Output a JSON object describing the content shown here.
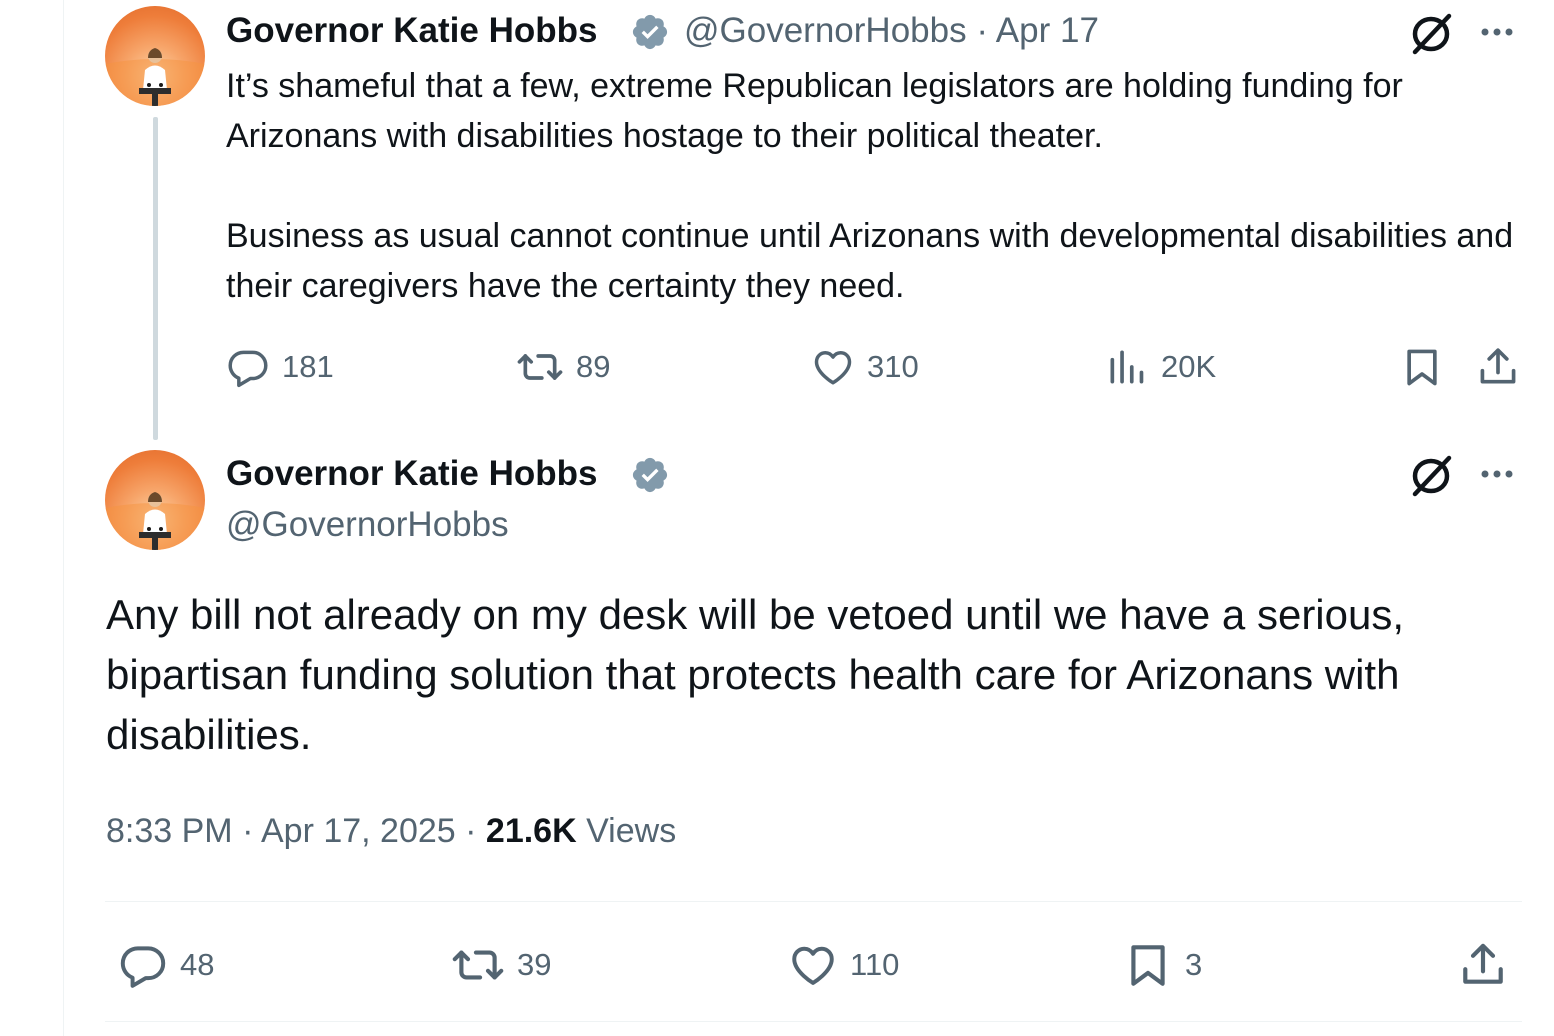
{
  "first_tweet": {
    "author_name": "Governor Katie Hobbs",
    "handle": "@GovernorHobbs",
    "separator": "·",
    "date": "Apr 17",
    "paragraph1": "It’s shameful that a few, extreme Republican legislators are holding funding for Arizonans with disabilities hostage to their political theater.",
    "paragraph2": "Business as usual cannot continue until Arizonans with developmental disabilities and their caregivers have the certainty they need.",
    "stats": {
      "replies": "181",
      "reposts": "89",
      "likes": "310",
      "views": "20K"
    }
  },
  "main_tweet": {
    "author_name": "Governor Katie Hobbs",
    "handle": "@GovernorHobbs",
    "text": "Any bill not already on my desk will be vetoed until we have a serious, bipartisan funding solution that protects health care for Arizonans with disabilities.",
    "time": "8:33 PM",
    "separator": "·",
    "date": "Apr 17, 2025",
    "views_count": "21.6K",
    "views_label": "Views",
    "stats": {
      "replies": "48",
      "reposts": "39",
      "likes": "110",
      "bookmarks": "3"
    }
  },
  "icons": {
    "verified": "verified-badge-icon",
    "grok": "grok-icon",
    "more": "more-icon",
    "reply": "reply-icon",
    "repost": "repost-icon",
    "like": "like-icon",
    "views": "views-icon",
    "bookmark": "bookmark-icon",
    "share": "share-icon"
  },
  "colors": {
    "text": "#0f1419",
    "secondary": "#536471",
    "verified_badge": "#829aab",
    "thread_line": "#cfd9de"
  }
}
